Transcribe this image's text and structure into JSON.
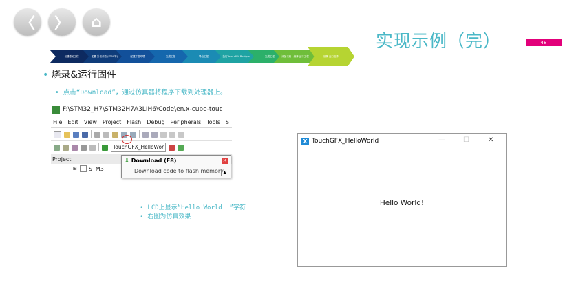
{
  "slide": {
    "title": "实现示例（完）",
    "page_number": "48",
    "accent_color": "#4ab8c7",
    "badge_color": "#e2007a"
  },
  "nav_buttons": [
    {
      "icon": "back-icon",
      "glyph": "〈"
    },
    {
      "icon": "forward-icon",
      "glyph": "〉"
    },
    {
      "icon": "home-icon",
      "glyph": "⌂"
    }
  ],
  "steps": [
    {
      "label": "创建基础工程",
      "color": "#0d2a60"
    },
    {
      "label": "配置 外设参数 (LTDC等)",
      "color": "#0f3c7a"
    },
    {
      "label": "配置开发环境",
      "color": "#12509a"
    },
    {
      "label": "生成工程",
      "color": "#1567ad"
    },
    {
      "label": "导出工程",
      "color": "#1b8bb4"
    },
    {
      "label": "执行TouchGFX Designer",
      "color": "#1fa3a3"
    },
    {
      "label": "生成工程",
      "color": "#2cb06a"
    },
    {
      "label": "添加代码 · 编译 运行工程",
      "color": "#6fbe3a"
    },
    {
      "label": "烧录 运行固件",
      "color": "#b6d432"
    }
  ],
  "bullet_main": "烧录&运行固件",
  "bullet_sub": "点击“Download”，通过仿真器将程序下载到处理器上。",
  "ide": {
    "title": "F:\\STM32_H7\\STM32H7A3LIH6\\Code\\en.x-cube-touc",
    "menu": [
      "File",
      "Edit",
      "View",
      "Project",
      "Flash",
      "Debug",
      "Peripherals",
      "Tools",
      "S"
    ],
    "target": "TouchGFX_HelloWor",
    "project_label": "Project",
    "tree_item": "STM3",
    "tooltip_title": "Download (F8)",
    "tooltip_desc": "Download code to flash memory"
  },
  "notes": [
    "LCD上显示“Hello World! ”字符",
    "右图为仿真效果"
  ],
  "sim_window": {
    "title": "TouchGFX_HelloWorld",
    "content": "Hello World!"
  }
}
